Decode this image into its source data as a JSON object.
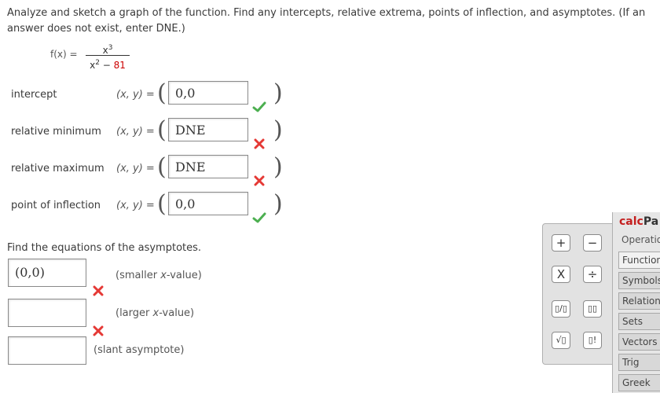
{
  "instructions": "Analyze and sketch a graph of the function. Find any intercepts, relative extrema, points of inflection, and asymptotes. (If an answer does not exist, enter DNE.)",
  "function": {
    "label": "f(x) =",
    "numerator": "x",
    "numerator_exp": "3",
    "denominator_base": "x",
    "denominator_exp": "2",
    "denominator_rest": " − ",
    "denominator_const": "81"
  },
  "rows": [
    {
      "label": "intercept",
      "xy_label": "(x, y)",
      "eq": " =",
      "value": "0,0",
      "status": "correct"
    },
    {
      "label": "relative minimum",
      "xy_label": "(x, y)",
      "eq": " =",
      "value": "DNE",
      "status": "incorrect"
    },
    {
      "label": "relative maximum",
      "xy_label": "(x, y)",
      "eq": " =",
      "value": "DNE",
      "status": "incorrect"
    },
    {
      "label": "point of inflection",
      "xy_label": "(x, y)",
      "eq": " =",
      "value": "0,0",
      "status": "correct"
    }
  ],
  "paren_open": "(",
  "paren_close": ")",
  "asymptotes": {
    "title": "Find the equations of the asymptotes.",
    "fields": [
      {
        "value": "(0,0)",
        "note_prefix": "(smaller ",
        "note_var": "x",
        "note_suffix": "-value)",
        "status": "incorrect"
      },
      {
        "value": "",
        "note_prefix": "(larger ",
        "note_var": "x",
        "note_suffix": "-value)",
        "status": "incorrect"
      },
      {
        "value": "",
        "note_prefix": "(slant asymptote)",
        "note_var": "",
        "note_suffix": "",
        "status": "none"
      }
    ]
  },
  "palette": {
    "buttons": [
      "+",
      "−",
      "X",
      "÷",
      "▯/▯",
      "▯▯",
      "√▯",
      "▯!"
    ]
  },
  "calcpad": {
    "title_calc": "calc",
    "title_rest": "Pa",
    "subtitle": "Operatio",
    "tabs": [
      "Function",
      "Symbols",
      "Relations",
      "Sets",
      "Vectors",
      "Trig",
      "Greek"
    ]
  },
  "colors": {
    "correct": "#4caf50",
    "incorrect": "#e53935"
  }
}
